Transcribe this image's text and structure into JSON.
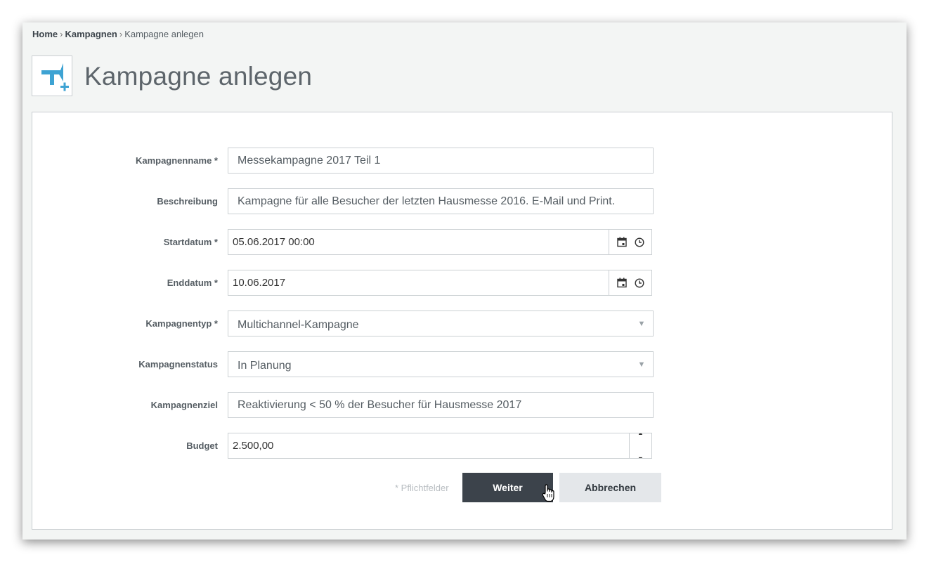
{
  "breadcrumb": {
    "home": "Home",
    "campaigns": "Kampagnen",
    "current": "Kampagne anlegen"
  },
  "page": {
    "title": "Kampagne anlegen",
    "icon": "megaphone-add-icon"
  },
  "form": {
    "name": {
      "label": "Kampagnenname *",
      "value": "Messekampagne 2017 Teil 1"
    },
    "description": {
      "label": "Beschreibung",
      "value": "Kampagne für alle Besucher der letzten Hausmesse 2016. E-Mail und Print."
    },
    "start": {
      "label": "Startdatum *",
      "value": "05.06.2017 00:00"
    },
    "end": {
      "label": "Enddatum *",
      "value": "10.06.2017"
    },
    "type": {
      "label": "Kampagnentyp *",
      "value": "Multichannel-Kampagne"
    },
    "status": {
      "label": "Kampagnenstatus",
      "value": "In Planung"
    },
    "goal": {
      "label": "Kampagnenziel",
      "value": "Reaktivierung < 50 % der Besucher für Hausmesse 2017"
    },
    "budget": {
      "label": "Budget",
      "value": "2.500,00"
    }
  },
  "footer": {
    "required_note": "* Pflichtfelder",
    "next_label": "Weiter",
    "cancel_label": "Abbrechen"
  },
  "colors": {
    "accent": "#3ea3d3",
    "primary_button": "#3c434b",
    "secondary_button": "#e4e7ea"
  }
}
